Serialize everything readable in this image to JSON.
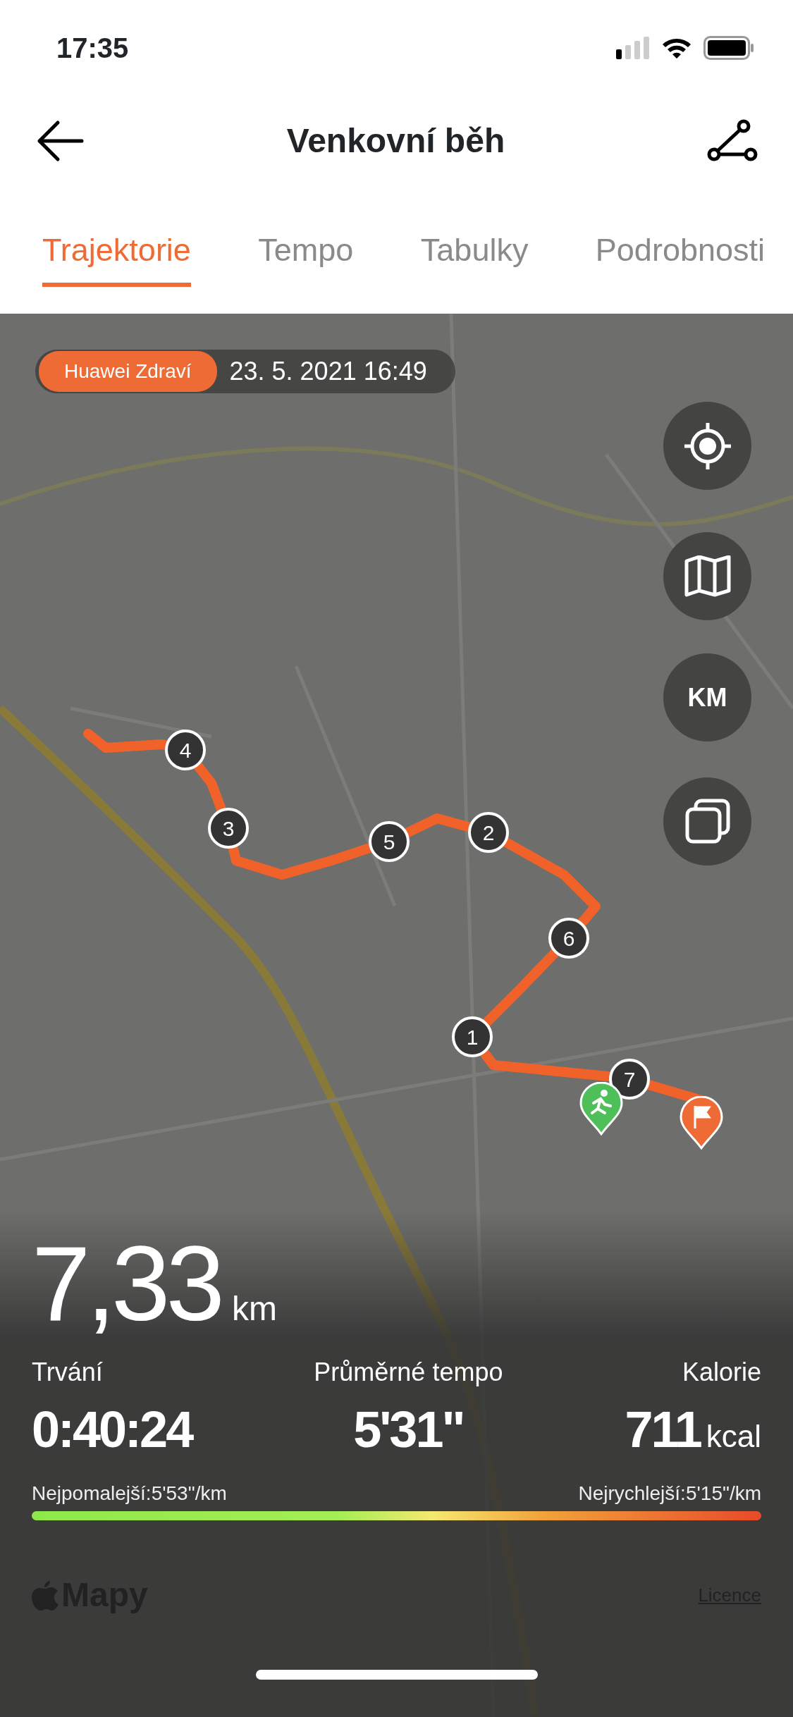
{
  "status_bar": {
    "time": "17:35"
  },
  "header": {
    "title": "Venkovní běh"
  },
  "tabs": [
    {
      "label": "Trajektorie",
      "selected": true
    },
    {
      "label": "Tempo",
      "selected": false
    },
    {
      "label": "Tabulky",
      "selected": false
    },
    {
      "label": "Podrobnosti",
      "selected": false
    }
  ],
  "map": {
    "source": "Huawei Zdraví",
    "date": "23. 5. 2021 16:49",
    "controls": [
      {
        "kind": "locate"
      },
      {
        "kind": "map"
      },
      {
        "kind": "unit",
        "label": "KM"
      },
      {
        "kind": "layers"
      }
    ],
    "km_markers": [
      {
        "label": "4"
      },
      {
        "label": "3"
      },
      {
        "label": "5"
      },
      {
        "label": "2"
      },
      {
        "label": "6"
      },
      {
        "label": "1"
      },
      {
        "label": "7"
      }
    ],
    "attribution": "Mapy",
    "licence": "Licence"
  },
  "summary": {
    "distance": "7,33",
    "distance_unit": "km",
    "stats": [
      {
        "label": "Trvání",
        "value": "0:40:24"
      },
      {
        "label": "Průměrné tempo",
        "value": "5'31\""
      },
      {
        "label": "Kalorie",
        "value": "711",
        "unit": "kcal"
      }
    ],
    "slowest": "Nejpomalejší:5'53\"/km",
    "fastest": "Nejrychlejší:5'15\"/km"
  }
}
